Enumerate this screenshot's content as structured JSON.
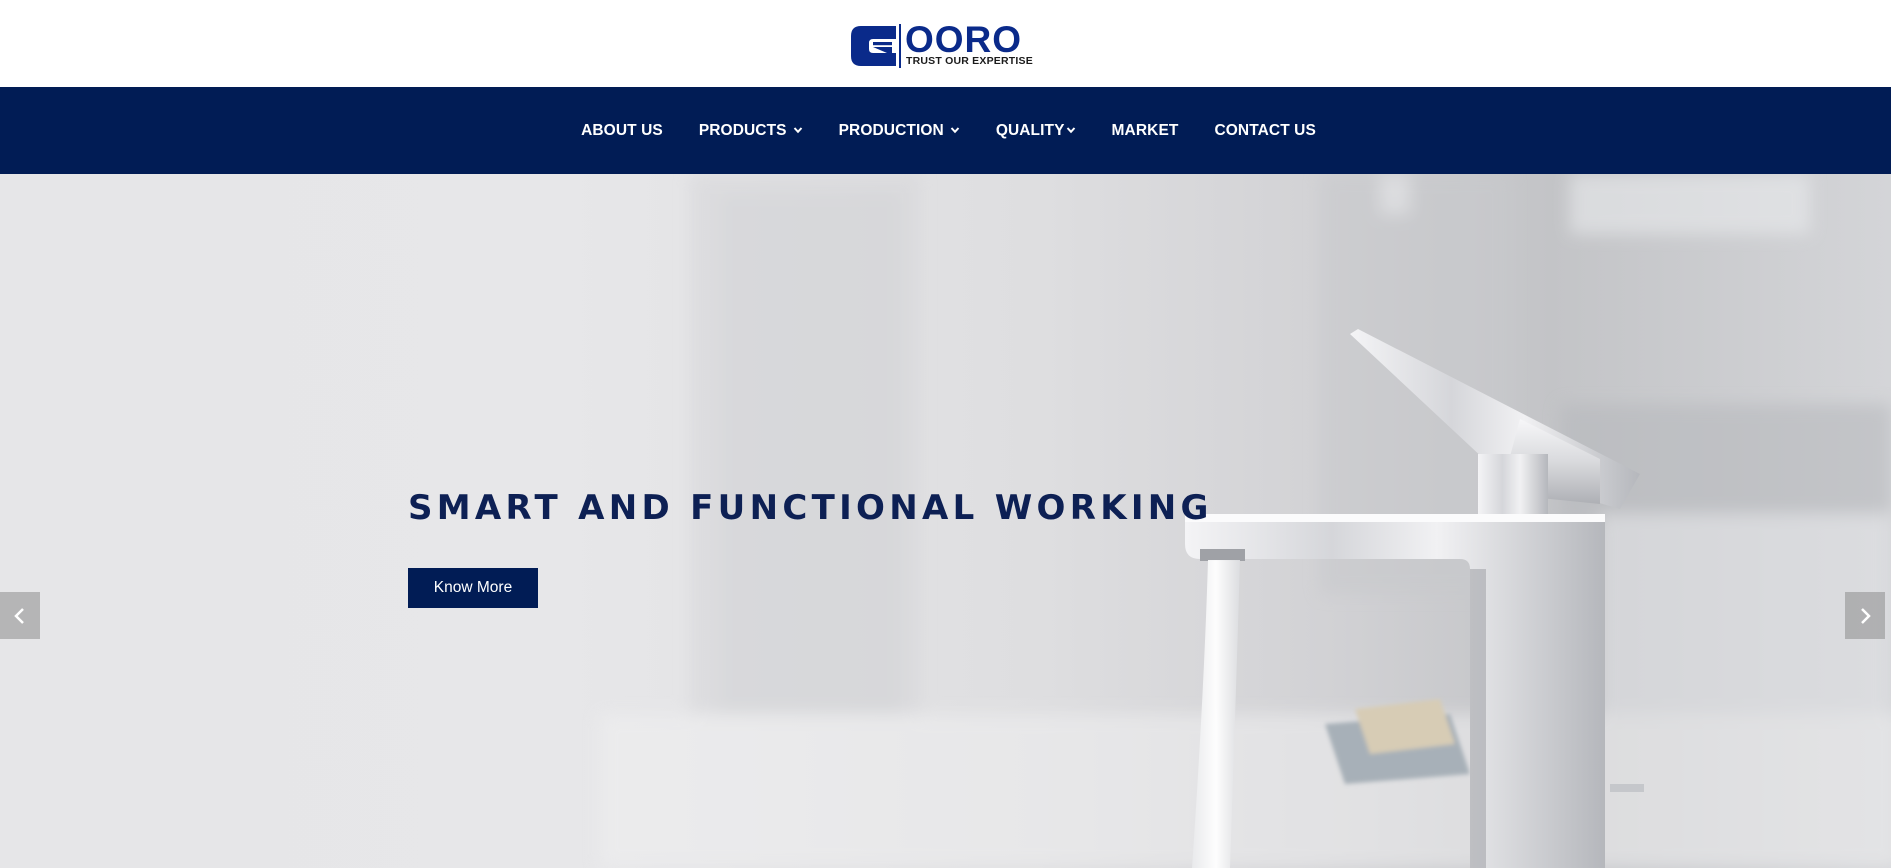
{
  "brand": {
    "name": "OORO",
    "tagline": "TRUST OUR EXPERTISE",
    "primary_color": "#011c55",
    "logo_color": "#0a2a8a"
  },
  "nav": {
    "items": [
      {
        "label": "ABOUT US",
        "has_dropdown": false
      },
      {
        "label": "PRODUCTS",
        "has_dropdown": true
      },
      {
        "label": "PRODUCTION",
        "has_dropdown": true
      },
      {
        "label": "QUALITY",
        "has_dropdown": true
      },
      {
        "label": "MARKET",
        "has_dropdown": false
      },
      {
        "label": "CONTACT US",
        "has_dropdown": false
      }
    ]
  },
  "hero": {
    "title": "SMART AND FUNCTIONAL WORKING",
    "button_label": "Know More",
    "prev_icon": "chevron-left-icon",
    "next_icon": "chevron-right-icon"
  }
}
